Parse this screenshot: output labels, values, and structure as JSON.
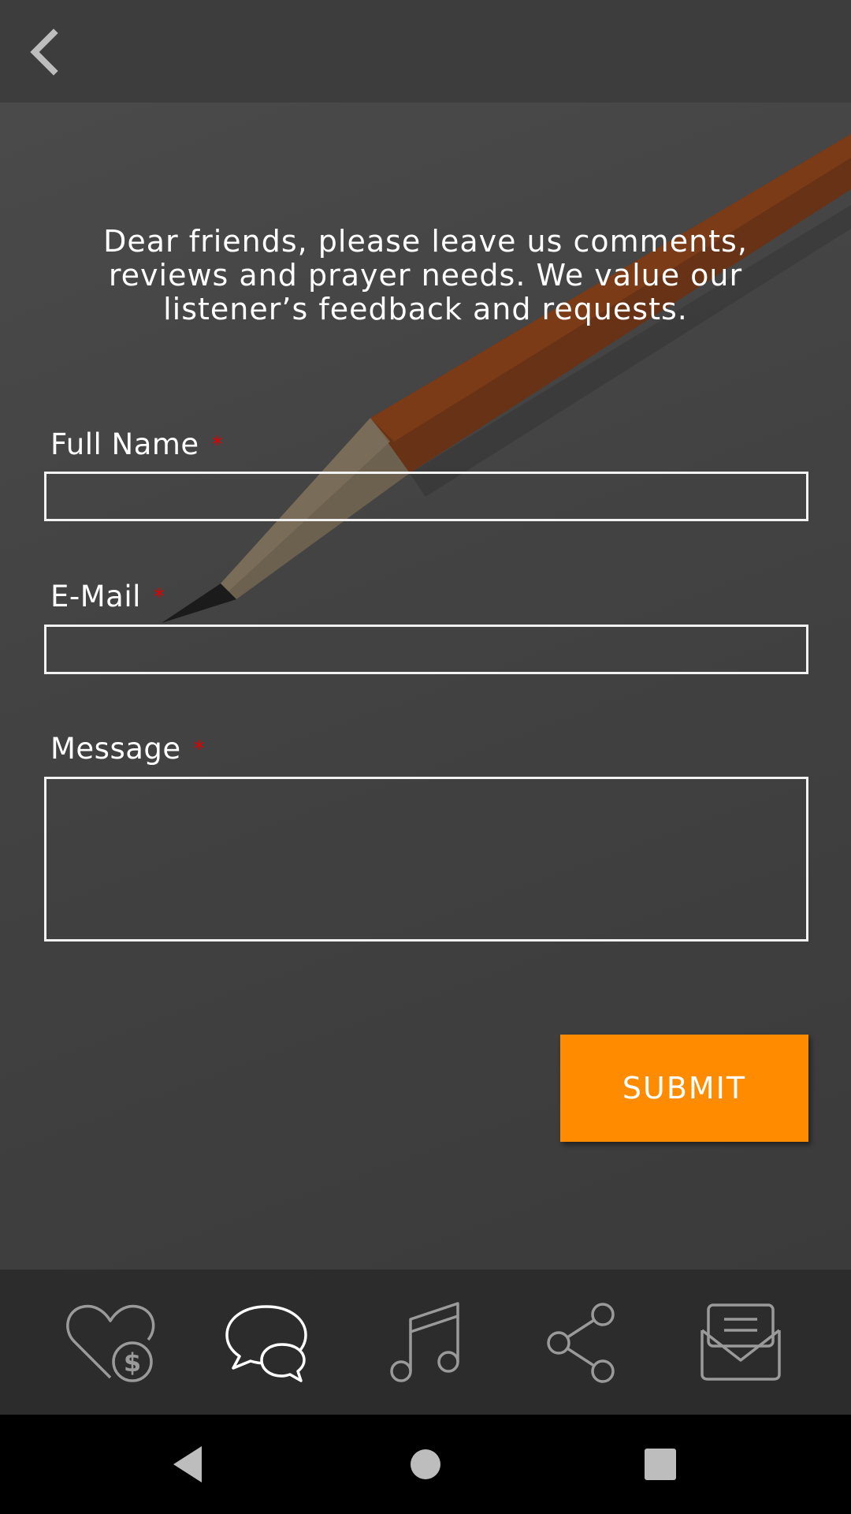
{
  "header": {
    "back_icon": "chevron-left-icon"
  },
  "intro": {
    "text": "Dear friends, please leave us comments, reviews and prayer needs. We value our listener’s feedback and requests."
  },
  "form": {
    "full_name": {
      "label": "Full Name",
      "required_mark": "*",
      "value": "",
      "placeholder": ""
    },
    "email": {
      "label": "E-Mail",
      "required_mark": "*",
      "value": "",
      "placeholder": ""
    },
    "message": {
      "label": "Message",
      "required_mark": "*",
      "value": "",
      "placeholder": ""
    },
    "submit_label": "SUBMIT"
  },
  "tab_bar": {
    "items": [
      {
        "icon": "donate-heart-dollar-icon",
        "active": false
      },
      {
        "icon": "chat-bubbles-icon",
        "active": true
      },
      {
        "icon": "music-note-icon",
        "active": false
      },
      {
        "icon": "share-icon",
        "active": false
      },
      {
        "icon": "mail-envelope-icon",
        "active": false
      }
    ]
  },
  "colors": {
    "accent": "#ff8c00",
    "required": "#e00000",
    "active_icon": "#ffffff",
    "inactive_icon": "#9a9a9a"
  }
}
